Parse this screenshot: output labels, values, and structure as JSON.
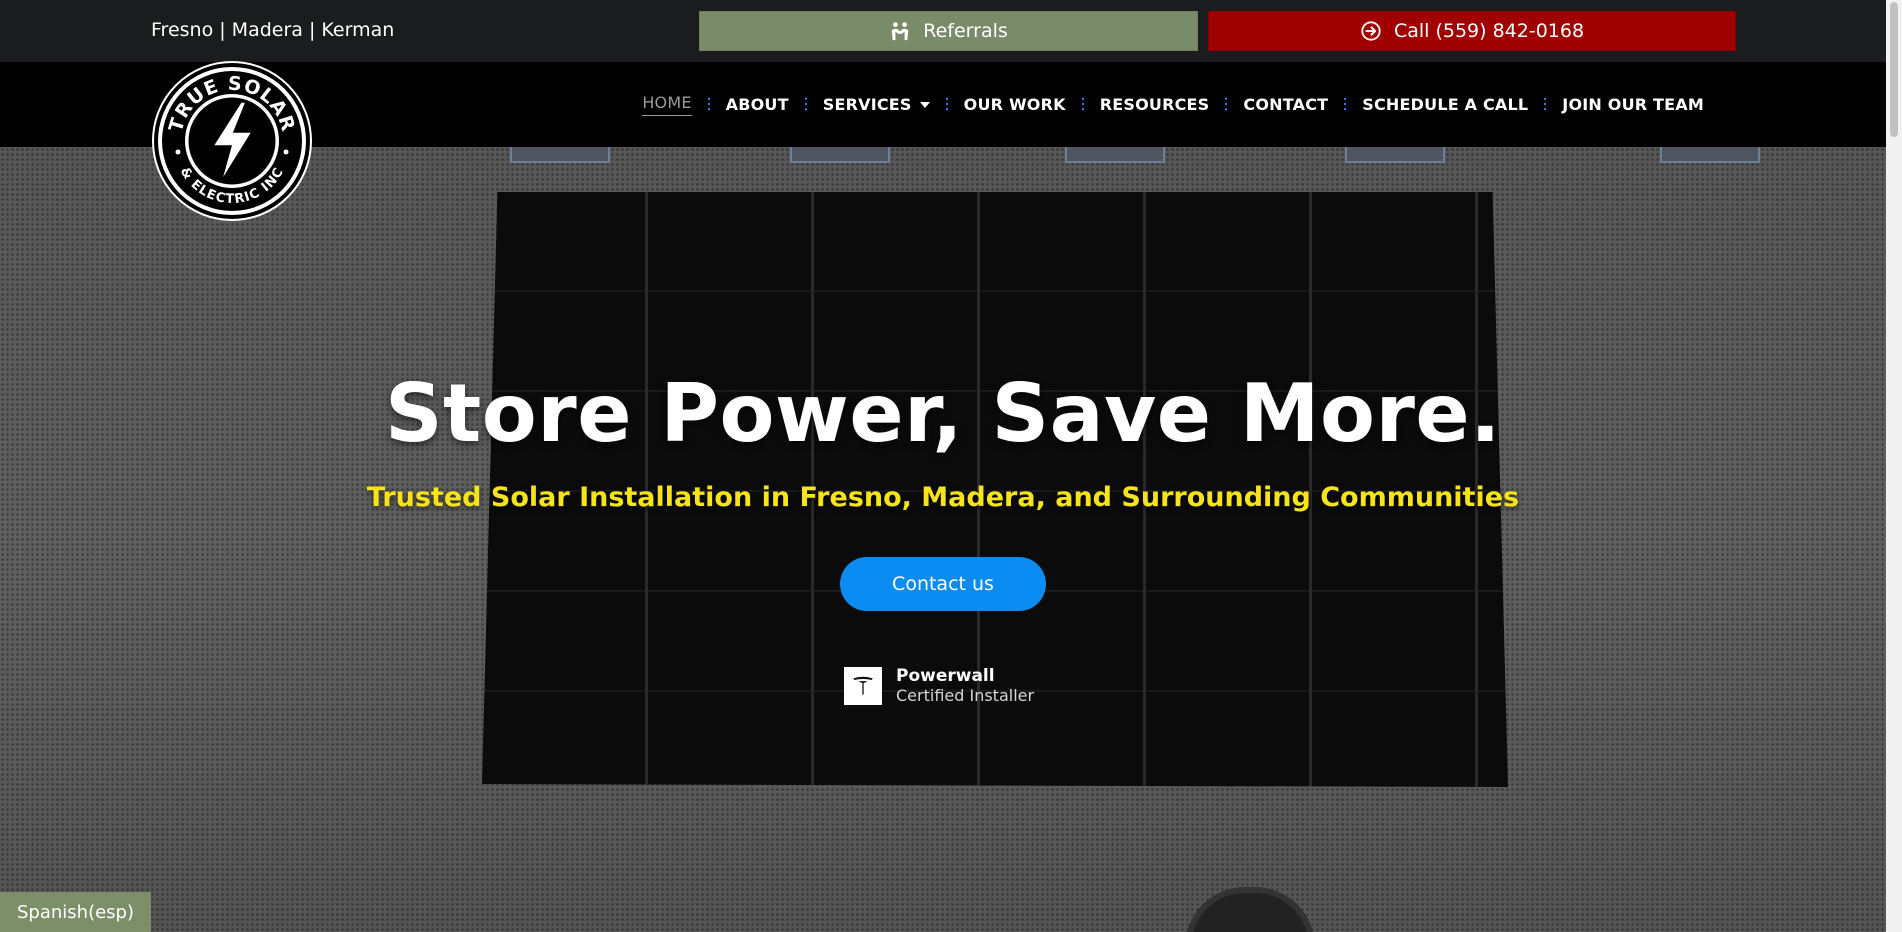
{
  "topbar": {
    "locations": "Fresno | Madera | Kerman",
    "referrals_label": "Referrals",
    "call_label": "Call (559) 842-0168",
    "referrals_color": "#7a8b6a",
    "call_color": "#a00000",
    "referrals_icon": "handshake-icon",
    "call_icon": "arrow-circle-right-icon"
  },
  "logo": {
    "line1": "TRUE SOLAR",
    "line2": "& ELECTRIC INC"
  },
  "nav": {
    "items": [
      {
        "label": "HOME",
        "active": true
      },
      {
        "label": "ABOUT"
      },
      {
        "label": "SERVICES",
        "has_dropdown": true
      },
      {
        "label": "OUR WORK"
      },
      {
        "label": "RESOURCES"
      },
      {
        "label": "CONTACT"
      },
      {
        "label": "SCHEDULE A CALL"
      },
      {
        "label": "JOIN OUR TEAM"
      }
    ]
  },
  "hero": {
    "title": "Store Power, Save More.",
    "subtitle": "Trusted Solar Installation in Fresno, Madera, and Surrounding Communities",
    "subtitle_color": "#f6e318",
    "cta_label": "Contact us",
    "cta_color": "#0b8cf3",
    "badge_title": "Powerwall",
    "badge_sub": "Certified Installer",
    "badge_icon": "tesla-icon"
  },
  "language": {
    "label": "Spanish(esp)"
  }
}
